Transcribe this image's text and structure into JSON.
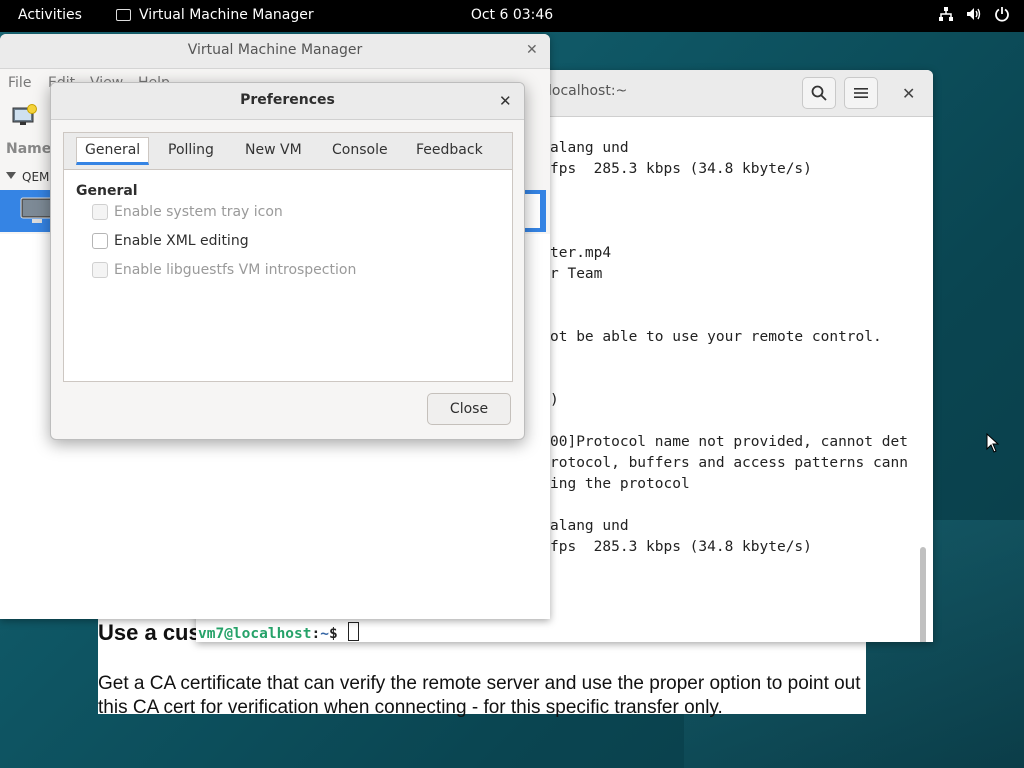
{
  "topbar": {
    "activities": "Activities",
    "app_name": "Virtual Machine Manager",
    "clock": "Oct 6  03:46",
    "status_icons": [
      "network-icon",
      "volume-icon",
      "power-icon"
    ]
  },
  "webpage": {
    "heading": "Use a cus",
    "paragraph": "Get a CA certificate that can verify the remote server and use the proper option to point out this CA cert for verification when connecting - for this specific transfer only."
  },
  "terminal": {
    "title": "localhost:~",
    "lines": [
      "alang und",
      "fps  285.3 kbps (34.8 kbyte/s)",
      "",
      "",
      "ter.mp4",
      "r Team",
      "",
      "",
      "ot be able to use your remote control.",
      "",
      "",
      ")",
      "",
      "00]Protocol name not provided, cannot det",
      "rotocol, buffers and access patterns cann",
      "ing the protocol",
      "",
      "alang und",
      "fps  285.3 kbps (34.8 kbyte/s)"
    ],
    "prompt_user": "vm7@localhost",
    "prompt_sep": ":",
    "prompt_path": "~",
    "prompt_sigil": "$ "
  },
  "vmm": {
    "title": "Virtual Machine Manager",
    "menu": [
      "File",
      "Edit",
      "View",
      "Help"
    ],
    "column_header": "Name",
    "group": "QEMU"
  },
  "prefs": {
    "title": "Preferences",
    "tabs": [
      "General",
      "Polling",
      "New VM",
      "Console",
      "Feedback"
    ],
    "active_tab": "General",
    "section_title": "General",
    "options": [
      {
        "label": "Enable system tray icon",
        "checked": false,
        "enabled": false
      },
      {
        "label": "Enable XML editing",
        "checked": false,
        "enabled": true
      },
      {
        "label": "Enable libguestfs VM introspection",
        "checked": false,
        "enabled": false
      }
    ],
    "close_label": "Close"
  },
  "colors": {
    "accent": "#3584e4",
    "prompt_user": "#26a269",
    "prompt_path": "#3465a4"
  }
}
